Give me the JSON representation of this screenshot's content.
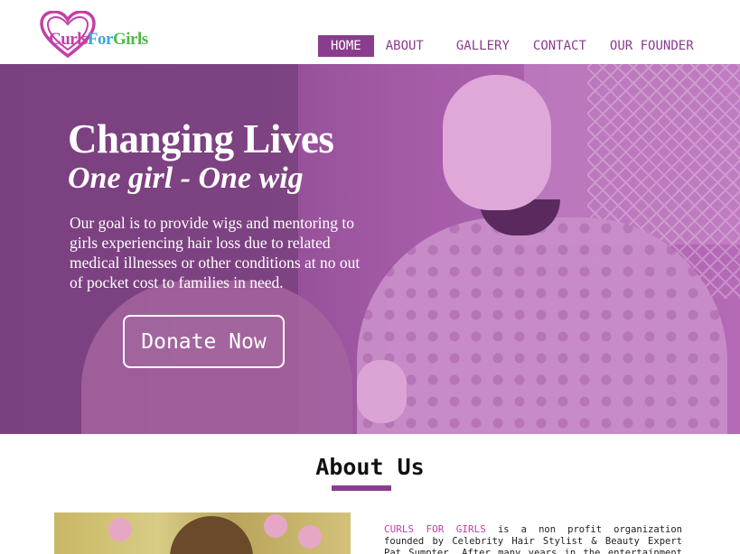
{
  "logo": {
    "part1": "Curls",
    "part2": "For",
    "part3": "Girls"
  },
  "nav": {
    "items": [
      {
        "label": "HOME",
        "active": true
      },
      {
        "label": "ABOUT",
        "active": false
      },
      {
        "label": "GALLERY",
        "active": false
      },
      {
        "label": "CONTACT",
        "active": false
      },
      {
        "label": "OUR FOUNDER",
        "active": false
      }
    ]
  },
  "hero": {
    "title": "Changing Lives",
    "subtitle": "One girl - One wig",
    "body": "Our goal is to provide wigs and mentoring to girls experiencing hair loss due to related medical illnesses or other conditions at no out of pocket cost to families in need.",
    "donate_label": "Donate Now"
  },
  "about": {
    "heading": "About Us",
    "brand": "CURLS FOR GIRLS",
    "text": " is a non profit organization founded by Celebrity Hair Stylist & Beauty Expert Pat Sumpter.  After many years in the entertainment industry, Sumpter"
  },
  "colors": {
    "accent": "#8a3d8e",
    "brand_pink": "#c43fa6",
    "brand_blue": "#3aa6e0",
    "brand_green": "#4fb84a"
  }
}
